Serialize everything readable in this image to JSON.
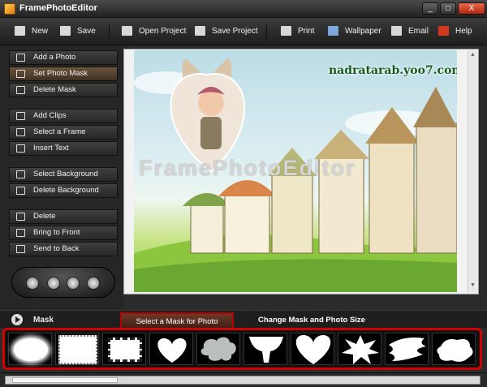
{
  "window": {
    "title": "FramePhotoEditor",
    "minimize": "_",
    "maximize": "□",
    "close": "X"
  },
  "toolbar": {
    "new": "New",
    "save": "Save",
    "open_project": "Open Project",
    "save_project": "Save Project",
    "print": "Print",
    "wallpaper": "Wallpaper",
    "email": "Email",
    "help": "Help"
  },
  "sidebar": {
    "items": [
      {
        "label": "Add a Photo"
      },
      {
        "label": "Set Photo Mask",
        "active": true
      },
      {
        "label": "Delete Mask"
      },
      {
        "label": "Add Clips"
      },
      {
        "label": "Select a Frame"
      },
      {
        "label": "Insert Text"
      },
      {
        "label": "Select Background"
      },
      {
        "label": "Delete Background"
      },
      {
        "label": "Delete"
      },
      {
        "label": "Bring to Front"
      },
      {
        "label": "Send to Back"
      }
    ]
  },
  "canvas": {
    "watermark_site": "nadratarab.yoo7.com",
    "watermark_app": "FramePhotoEditor"
  },
  "panel": {
    "label": "Mask",
    "tabs": [
      "Select a Mask for Photo",
      "Change Mask and Photo Size"
    ],
    "active_tab": 0
  },
  "masks": [
    "oval-blur",
    "rect-soft",
    "rect-stamp",
    "heart",
    "cloud",
    "goblet",
    "heart-large",
    "burst",
    "brush-stroke",
    "splat"
  ],
  "colors": {
    "accent": "#d40000",
    "active_tab": "#6c3a28",
    "active_button": "#6a553c"
  }
}
